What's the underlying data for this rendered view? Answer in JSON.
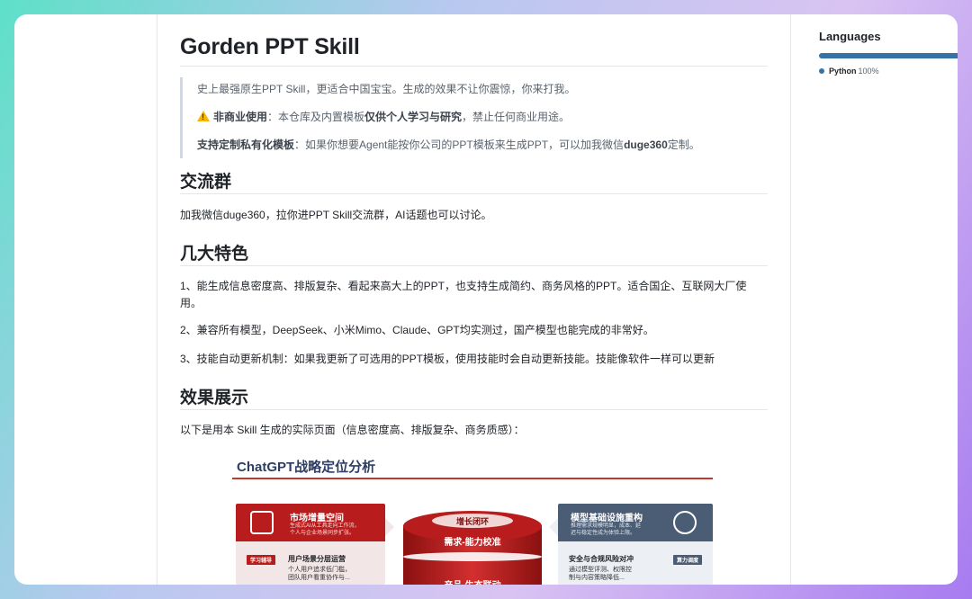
{
  "readme": {
    "title": "Gorden PPT Skill",
    "quote": {
      "line1": "史上最强原生PPT Skill，更适合中国宝宝。生成的效果不让你震惊，你来打我。",
      "line2_bold1": "非商业使用",
      "line2_text1": "：本仓库及内置模板",
      "line2_bold2": "仅供个人学习与研究",
      "line2_text2": "，禁止任何商业用途。",
      "line3_bold1": "支持定制私有化模板",
      "line3_text1": "：如果你想要Agent能按你公司的PPT模板来生成PPT，可以加我微信",
      "line3_bold2": "duge360",
      "line3_text2": "定制。"
    },
    "sections": [
      {
        "heading": "交流群",
        "paragraphs": [
          "加我微信duge360，拉你进PPT Skill交流群，AI话题也可以讨论。"
        ]
      },
      {
        "heading": "几大特色",
        "paragraphs": [
          "1、能生成信息密度高、排版复杂、看起来高大上的PPT，也支持生成简约、商务风格的PPT。适合国企、互联网大厂使用。",
          "2、兼容所有模型，DeepSeek、小米Mimo、Claude、GPT均实测过，国产模型也能完成的非常好。",
          "3、技能自动更新机制：如果我更新了可选用的PPT模板，使用技能时会自动更新技能。技能像软件一样可以更新"
        ]
      },
      {
        "heading": "效果展示",
        "paragraphs": [
          "以下是用本 Skill 生成的实际页面（信息密度高、排版复杂、商务质感）："
        ]
      }
    ]
  },
  "slide": {
    "title": "ChatGPT战略定位分析",
    "left_card": {
      "title": "市场增量空间",
      "sub1": "生成式AI从工具走向工作流，",
      "sub2": "个人与企业场景同步扩张。",
      "tag": "学习辅导",
      "item_title": "用户场景分层运营",
      "item_text1": "个人用户追求低门槛，",
      "item_text2": "团队用户看重协作与..."
    },
    "center": {
      "top_label": "增长闭环",
      "label1": "需求-能力校准",
      "label2": "产品-生态联动"
    },
    "right_card": {
      "title": "模型基础设施重构",
      "sub1": "推理需求规模明显，成本、延",
      "sub2": "迟与稳定性成为体验上限。",
      "tag": "算力调度",
      "item_title": "安全与合规风险对冲",
      "item_text1": "通过模型评测、权限控",
      "item_text2": "制与内容策略降低..."
    }
  },
  "sidebar": {
    "languages_title": "Languages",
    "language_name": "Python",
    "language_percent": "100%",
    "language_share": 1.0,
    "language_color": "#3572a5"
  },
  "colors": {
    "accent_red": "#b91c1c",
    "slate": "#4b5d75"
  }
}
